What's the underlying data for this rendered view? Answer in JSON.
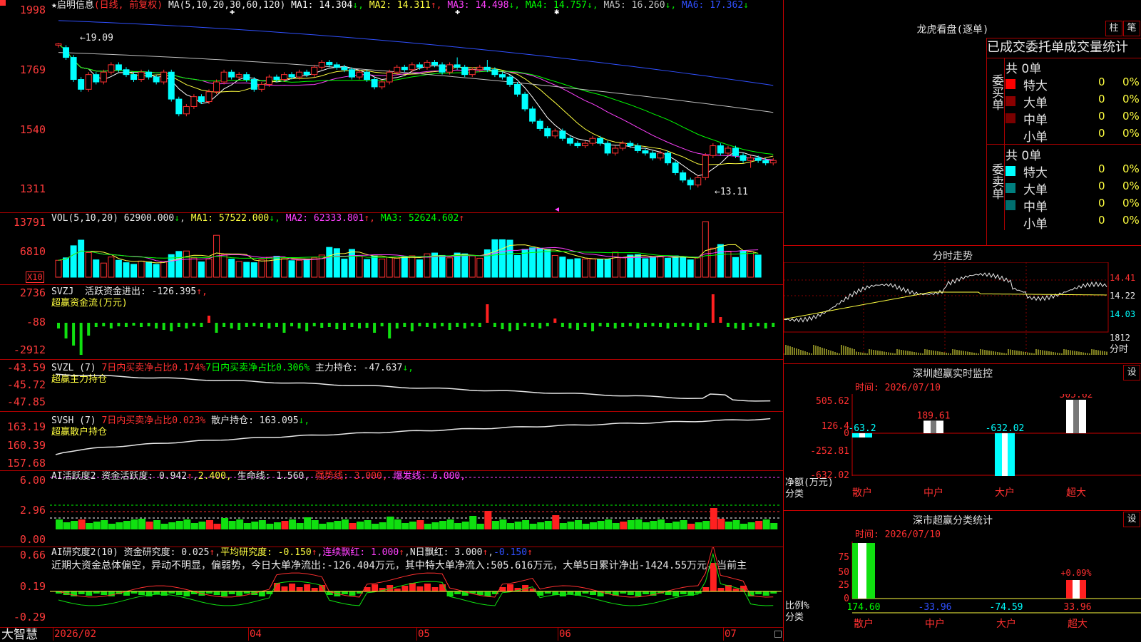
{
  "main_chart": {
    "stock_title": "★启明信息",
    "period_note": "(日线, 前复权)",
    "ma_label": "MA(5,10,20,30,60,120)",
    "ma_values": [
      {
        "name": "MA1:",
        "value": "14.304",
        "arrow": "↓",
        "color": "#ffffff"
      },
      {
        "name": "MA2:",
        "value": "14.311",
        "arrow": "↑",
        "color": "#ffff40"
      },
      {
        "name": "MA3:",
        "value": "14.498",
        "arrow": "↓",
        "color": "#ff40ff"
      },
      {
        "name": "MA4:",
        "value": "14.757",
        "arrow": "↓",
        "color": "#00ff00"
      },
      {
        "name": "MA5:",
        "value": "16.260",
        "arrow": "↓",
        "color": "#c0c0c0"
      },
      {
        "name": "MA6:",
        "value": "17.362",
        "arrow": "↓",
        "color": "#3050ff"
      }
    ],
    "y_ticks": [
      "1998",
      "1769",
      "1540",
      "1311"
    ],
    "high_mark": "19.09",
    "low_mark": "13.11"
  },
  "volume": {
    "label": "VOL(5,10,20)",
    "value": "62900.000",
    "ma": [
      {
        "name": "MA1:",
        "value": "57522.000",
        "arrow": "↓",
        "color": "#ffff40"
      },
      {
        "name": "MA2:",
        "value": "62333.801",
        "arrow": "↑",
        "color": "#ff40ff"
      },
      {
        "name": "MA3:",
        "value": "52624.602",
        "arrow": "↑",
        "color": "#00ff00"
      }
    ],
    "y_ticks": [
      "13791",
      "6810"
    ],
    "unit": "X10"
  },
  "svzj": {
    "label": "SVZJ",
    "text": "活跃资金进出: -126.395",
    "arrow": "↑,",
    "subtitle": "超赢资金流(万元)",
    "y_ticks": [
      "2736",
      "-88",
      "-2912"
    ]
  },
  "svzl": {
    "label": "SVZL (7)",
    "t1": "7日内买卖净占比0.174%",
    "t2": "7日内买卖净占比0.306%",
    "t3": "主力持仓: -47.637",
    "arrow": "↓,",
    "subtitle": "超赢主力持仓",
    "y_ticks": [
      "-43.59",
      "-45.72",
      "-47.85"
    ]
  },
  "svsh": {
    "label": "SVSH (7)",
    "t1": "7日内买卖净占比0.023%",
    "t2": "散户持仓: 163.095",
    "arrow": "↓,",
    "subtitle": "超赢散户持仓",
    "y_ticks": [
      "163.19",
      "160.39",
      "157.68"
    ]
  },
  "ai_active": {
    "label": "AI活跃度2",
    "t1": "资金活跃度: 0.942",
    "t2": "2.400,",
    "t3": "生命线: 1.560,",
    "t4": "强势线: 3.000,",
    "t5": "爆发线: 6.000,",
    "y_ticks": [
      "6.00",
      "2.96",
      "0.00"
    ]
  },
  "ai_research": {
    "label": "AI研究度2(10)",
    "t1": "资金研究度: 0.025",
    "t2": "平均研究度: -0.150",
    "t3": "连续飘红: 1.000",
    "t4": "N日飘红: 3.000",
    "t5": "-0.150",
    "comment": "近期大资金总体偏空，异动不明显，偏弱势，今日大单净流出:-126.404万元，其中特大单净流入:505.616万元，大单5日累计净出-1424.55万元，当前主",
    "y_ticks": [
      "0.66",
      "0.19",
      "-0.29"
    ]
  },
  "bottom_bar": {
    "brand": "大智慧",
    "dates": [
      "2026/02",
      "04",
      "05",
      "06",
      "07"
    ]
  },
  "right_panel": {
    "dragon_title": "龙虎看盘(逐单)",
    "btn1": "柱",
    "btn2": "笔",
    "order_header": "已成交委托单成交量统计",
    "buy_label": "委买单",
    "sell_label": "委卖单",
    "buy_total": "共 0单",
    "sell_total": "共 0单",
    "rows": [
      {
        "label": "特大",
        "count": "0",
        "pct": "0%"
      },
      {
        "label": "大单",
        "count": "0",
        "pct": "0%"
      },
      {
        "label": "中单",
        "count": "0",
        "pct": "0%"
      },
      {
        "label": "小单",
        "count": "0",
        "pct": "0%"
      }
    ],
    "intraday_title": "分时走势",
    "intraday_ticks": [
      "14.41",
      "14.22",
      "14.03",
      "1812"
    ],
    "intraday_unit": "分时",
    "monitor_title": "深圳超赢实时监控",
    "monitor_btn": "设",
    "monitor_time": "时间: 2026/07/10",
    "monitor_yticks": [
      "505.62",
      "126.4",
      "0",
      "-252.81",
      "-632.02"
    ],
    "monitor_side_labels": [
      "净额(万元)",
      "分类"
    ],
    "monitor_cats": [
      "散户",
      "中户",
      "大户",
      "超大"
    ],
    "monitor_vals": [
      "-63.2",
      "189.61",
      "-632.02",
      "505.62"
    ],
    "class_title": "深市超赢分类统计",
    "class_btn": "设",
    "class_time": "时间: 2026/07/10",
    "class_yticks": [
      "75",
      "50",
      "25",
      "0"
    ],
    "class_side_labels": [
      "比例%",
      "分类"
    ],
    "class_cats": [
      "散户",
      "中户",
      "大户",
      "超大"
    ],
    "class_vals": [
      "174.60",
      "-33.96",
      "-74.59",
      "33.96"
    ],
    "class_note": "+0.09%"
  },
  "chart_data": [
    {
      "type": "candlestick",
      "title": "启明信息 日线 前复权",
      "ylim": [
        13.0,
        20.2
      ],
      "up_color": "#ff3030",
      "down_color": "#00ffff",
      "series": [
        {
          "name": "MA5",
          "color": "#ffffff"
        },
        {
          "name": "MA10",
          "color": "#ffff40"
        },
        {
          "name": "MA20",
          "color": "#ff40ff"
        },
        {
          "name": "MA30",
          "color": "#00ff00"
        },
        {
          "name": "MA60",
          "color": "#c0c0c0"
        },
        {
          "name": "MA120",
          "color": "#3050ff"
        }
      ],
      "high": 19.09,
      "low": 13.11,
      "candles": [
        [
          19.0,
          19.05,
          18.9,
          19.09
        ],
        [
          18.9,
          18.5,
          18.4,
          19.0
        ],
        [
          18.5,
          17.6,
          17.5,
          18.6
        ],
        [
          17.6,
          17.2,
          17.1,
          17.7
        ],
        [
          17.2,
          17.8,
          17.1,
          17.9
        ],
        [
          17.8,
          17.5,
          17.4,
          17.9
        ],
        [
          17.5,
          17.9,
          17.4,
          18.0
        ],
        [
          17.9,
          18.2,
          17.8,
          18.3
        ],
        [
          18.2,
          18.0,
          17.9,
          18.3
        ],
        [
          18.0,
          17.8,
          17.7,
          18.1
        ],
        [
          17.8,
          17.6,
          17.5,
          17.9
        ],
        [
          17.6,
          17.9,
          17.5,
          18.0
        ],
        [
          17.9,
          17.7,
          17.6,
          18.0
        ],
        [
          17.7,
          17.5,
          17.4,
          17.8
        ],
        [
          17.5,
          17.9,
          17.4,
          18.0
        ],
        [
          17.9,
          16.8,
          16.7,
          18.0
        ],
        [
          16.8,
          16.2,
          16.1,
          16.9
        ],
        [
          16.2,
          16.5,
          16.1,
          16.6
        ],
        [
          16.5,
          16.9,
          16.4,
          17.0
        ],
        [
          16.9,
          16.7,
          16.6,
          17.0
        ],
        [
          16.7,
          17.1,
          16.6,
          17.2
        ],
        [
          17.1,
          17.5,
          17.0,
          17.6
        ],
        [
          17.5,
          17.9,
          17.4,
          18.0
        ],
        [
          17.9,
          17.7,
          17.6,
          18.0
        ],
        [
          17.7,
          17.8,
          17.6,
          17.9
        ],
        [
          17.8,
          17.6,
          17.5,
          17.9
        ],
        [
          17.6,
          17.2,
          17.1,
          17.7
        ],
        [
          17.2,
          17.4,
          17.1,
          17.5
        ],
        [
          17.4,
          17.7,
          17.3,
          17.8
        ],
        [
          17.7,
          17.6,
          17.5,
          17.8
        ],
        [
          17.6,
          17.8,
          17.5,
          17.9
        ],
        [
          17.8,
          17.7,
          17.6,
          17.9
        ],
        [
          17.7,
          17.9,
          17.6,
          18.0
        ],
        [
          17.9,
          17.8,
          17.7,
          18.0
        ],
        [
          17.8,
          18.1,
          17.7,
          18.2
        ],
        [
          18.1,
          18.3,
          18.0,
          18.4
        ],
        [
          18.3,
          18.2,
          18.1,
          18.4
        ],
        [
          18.2,
          18.1,
          18.0,
          18.3
        ],
        [
          18.1,
          18.0,
          17.9,
          18.2
        ],
        [
          18.0,
          17.7,
          17.6,
          18.1
        ],
        [
          17.7,
          17.9,
          17.6,
          18.0
        ],
        [
          17.9,
          17.6,
          17.5,
          18.0
        ],
        [
          17.6,
          17.3,
          17.2,
          17.7
        ],
        [
          17.3,
          17.5,
          17.2,
          17.6
        ],
        [
          17.5,
          17.9,
          17.4,
          18.0
        ],
        [
          17.9,
          18.1,
          17.8,
          18.2
        ],
        [
          18.1,
          18.0,
          17.9,
          18.2
        ],
        [
          18.0,
          18.2,
          17.9,
          18.3
        ],
        [
          18.2,
          18.1,
          18.0,
          18.3
        ],
        [
          18.1,
          18.3,
          18.0,
          18.4
        ],
        [
          18.3,
          18.2,
          18.1,
          18.4
        ],
        [
          18.2,
          17.9,
          17.8,
          18.3
        ],
        [
          17.9,
          18.2,
          17.8,
          18.3
        ],
        [
          18.2,
          18.1,
          18.0,
          18.5
        ],
        [
          18.1,
          17.8,
          17.7,
          18.2
        ],
        [
          17.8,
          18.0,
          17.7,
          18.1
        ],
        [
          18.0,
          18.1,
          17.9,
          18.2
        ],
        [
          18.1,
          18.0,
          17.9,
          18.4
        ],
        [
          18.0,
          17.8,
          17.7,
          18.1
        ],
        [
          17.8,
          17.7,
          17.6,
          17.9
        ],
        [
          17.7,
          17.4,
          17.3,
          17.8
        ],
        [
          17.4,
          17.0,
          16.9,
          17.5
        ],
        [
          17.0,
          16.4,
          16.3,
          17.1
        ],
        [
          16.4,
          15.9,
          15.8,
          16.5
        ],
        [
          15.9,
          15.6,
          15.5,
          16.0
        ],
        [
          15.6,
          15.3,
          15.2,
          15.7
        ],
        [
          15.3,
          15.5,
          15.2,
          15.6
        ],
        [
          15.5,
          15.2,
          15.1,
          15.6
        ],
        [
          15.2,
          15.0,
          14.9,
          15.3
        ],
        [
          15.0,
          14.9,
          14.8,
          15.1
        ],
        [
          14.9,
          15.0,
          14.8,
          15.1
        ],
        [
          15.0,
          15.2,
          14.9,
          15.3
        ],
        [
          15.2,
          15.0,
          14.9,
          15.3
        ],
        [
          15.0,
          14.6,
          14.5,
          15.1
        ],
        [
          14.6,
          14.8,
          14.5,
          14.9
        ],
        [
          14.8,
          15.0,
          14.7,
          15.1
        ],
        [
          15.0,
          14.9,
          14.8,
          15.1
        ],
        [
          14.9,
          14.7,
          14.6,
          15.0
        ],
        [
          14.7,
          14.6,
          14.5,
          14.8
        ],
        [
          14.6,
          14.4,
          14.3,
          14.7
        ],
        [
          14.4,
          14.6,
          14.3,
          14.7
        ],
        [
          14.6,
          14.2,
          14.1,
          14.7
        ],
        [
          14.2,
          13.8,
          13.7,
          14.3
        ],
        [
          13.8,
          13.5,
          13.4,
          13.9
        ],
        [
          13.5,
          13.3,
          13.11,
          13.6
        ],
        [
          13.3,
          13.6,
          13.2,
          13.7
        ],
        [
          13.6,
          14.5,
          13.5,
          14.6
        ],
        [
          14.5,
          14.9,
          14.4,
          15.0
        ],
        [
          14.9,
          14.6,
          14.5,
          15.0
        ],
        [
          14.6,
          14.8,
          14.5,
          14.9
        ],
        [
          14.8,
          14.5,
          14.4,
          14.9
        ],
        [
          14.5,
          14.3,
          14.2,
          14.6
        ],
        [
          14.3,
          14.4,
          14.0,
          14.5
        ],
        [
          14.4,
          14.3,
          14.2,
          14.5
        ],
        [
          14.3,
          14.2,
          14.1,
          14.4
        ],
        [
          14.2,
          14.3,
          14.1,
          14.4
        ]
      ]
    },
    {
      "type": "bar",
      "title": "VOL(5,10,20)",
      "ylim": [
        0,
        14500
      ],
      "values": [
        4200,
        4800,
        7800,
        9200,
        6100,
        4300,
        3500,
        5000,
        4200,
        3600,
        3200,
        4000,
        3800,
        3200,
        3900,
        5600,
        6400,
        6500,
        4800,
        3800,
        4500,
        10400,
        5600,
        4500,
        3900,
        3700,
        3600,
        4300,
        4900,
        5200,
        4600,
        4100,
        4200,
        4500,
        4800,
        5500,
        7400,
        7100,
        4500,
        6900,
        5200,
        4400,
        5300,
        4500,
        4900,
        4700,
        5100,
        5300,
        4300,
        5800,
        6000,
        5400,
        4800,
        6000,
        5800,
        5300,
        4700,
        6800,
        9300,
        9300,
        9200,
        5400,
        6900,
        7300,
        7200,
        6900,
        5400,
        5000,
        4400,
        4600,
        4500,
        4500,
        4500,
        4500,
        6200,
        4800,
        5500,
        5600,
        4600,
        5000,
        5200,
        4700,
        5300,
        4900,
        4300,
        4800,
        13791,
        7200,
        8100,
        6300,
        4900,
        6600,
        6290,
        5500
      ],
      "colors_rule": "up=red hollow, down=cyan filled"
    }
  ]
}
